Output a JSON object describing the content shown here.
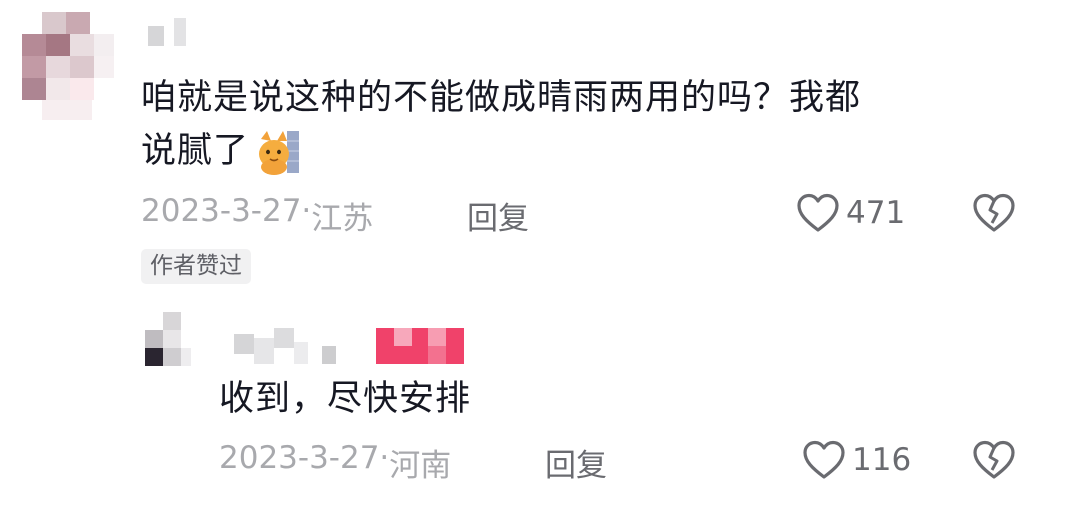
{
  "comment": {
    "text_line1": "咱就是说这种的不能做成晴雨两用的吗？我都",
    "text_line2": "说腻了",
    "date": "2023-3-27·",
    "location": "江苏",
    "reply_label": "回复",
    "like_count": "471",
    "author_liked_badge": "作者赞过"
  },
  "reply": {
    "text": "收到，尽快安排",
    "date": "2023-3-27·",
    "location": "河南",
    "reply_label": "回复",
    "like_count": "116"
  },
  "colors": {
    "text": "#161823",
    "meta": "#a8a9ad",
    "author_tag": "#fe2c55"
  },
  "icons": [
    "heart-outline-icon",
    "broken-heart-icon",
    "cat-emoji-icon"
  ]
}
